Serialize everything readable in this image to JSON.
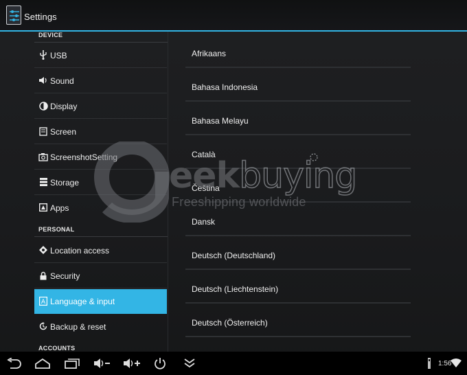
{
  "window": {
    "title": "Settings"
  },
  "colors": {
    "accent": "#33b5e5",
    "background": "#1c1d1f"
  },
  "left_panel": {
    "device_header": "DEVICE",
    "device_items": [
      {
        "label": "USB",
        "icon": "usb-icon"
      },
      {
        "label": "Sound",
        "icon": "volume-icon"
      },
      {
        "label": "Display",
        "icon": "brightness-icon"
      },
      {
        "label": "Screen",
        "icon": "screen-icon"
      },
      {
        "label": "ScreenshotSetting",
        "icon": "camera-icon"
      },
      {
        "label": "Storage",
        "icon": "storage-icon"
      },
      {
        "label": "Apps",
        "icon": "apps-icon"
      }
    ],
    "personal_header": "PERSONAL",
    "personal_items": [
      {
        "label": "Location access",
        "icon": "location-icon"
      },
      {
        "label": "Security",
        "icon": "lock-icon"
      },
      {
        "label": "Language & input",
        "icon": "language-icon",
        "selected": true
      },
      {
        "label": "Backup & reset",
        "icon": "backup-icon"
      }
    ],
    "accounts_header": "ACCOUNTS"
  },
  "languages": [
    "Afrikaans",
    "Bahasa Indonesia",
    "Bahasa Melayu",
    "Català",
    "Čeština",
    "Dansk",
    "Deutsch (Deutschland)",
    "Deutsch (Liechtenstein)",
    "Deutsch (Österreich)"
  ],
  "watermark": {
    "letter": "g",
    "word_part1": "eek",
    "word_part2": "buying",
    "tagline": "Freeshipping worldwide"
  },
  "navbar": {
    "buttons": [
      "back-icon",
      "home-icon",
      "recent-apps-icon",
      "volume-down-icon",
      "volume-up-icon",
      "power-icon",
      "hide-bar-icon"
    ]
  },
  "status": {
    "time": "1:56",
    "icons": [
      "usb-debug-icon",
      "wifi-icon"
    ]
  }
}
